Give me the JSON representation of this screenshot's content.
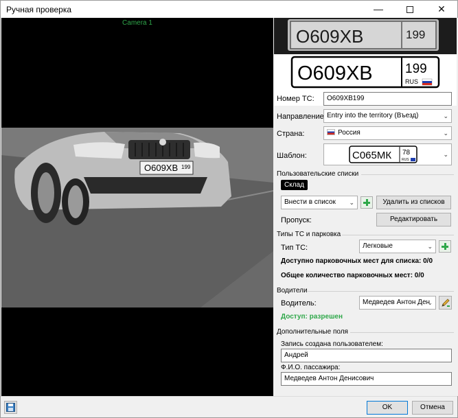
{
  "window": {
    "title": "Ручная проверка",
    "minimize_glyph": "—",
    "close_glyph": "✕"
  },
  "video": {
    "camera_label": "Camera 1",
    "scene_plate_text": "O609XB",
    "scene_plate_region": "199"
  },
  "plate_crop": {
    "text": "O609XB",
    "region": "199"
  },
  "plate_render": {
    "number": "О609ХВ",
    "region": "199",
    "country_code": "RUS"
  },
  "form": {
    "plate_label": "Номер ТС:",
    "plate_value": "О609ХВ199",
    "direction_label": "Направление:",
    "direction_value": "Entry into the territory (Въезд)",
    "country_label": "Страна:",
    "country_value": "Россия",
    "template_label": "Шаблон:",
    "template_plate": {
      "number": "С065МК",
      "region": "78",
      "country_code": "RUS"
    }
  },
  "user_lists": {
    "section_title": "Пользовательские списки",
    "tag": "Склад",
    "add_to_list_value": "Внести в список",
    "remove_button": "Удалить из списков",
    "pass_label": "Пропуск:",
    "edit_button": "Редактировать"
  },
  "vehicle_types": {
    "section_title": "Типы ТС и парковка",
    "type_label": "Тип ТС:",
    "type_value": "Легковые",
    "available_list": "Доступно парковочных мест для списка: 0/0",
    "total_places": "Общее количество парковочных мест: 0/0"
  },
  "drivers": {
    "section_title": "Водители",
    "driver_label": "Водитель:",
    "driver_value": "Медведев Антон Ден",
    "access_status": "Доступ: разрешен",
    "access_color": "#2fa84a"
  },
  "extra": {
    "section_title": "Дополнительные поля",
    "created_by_label": "Запись создана пользователем:",
    "created_by_value": "Андрей",
    "passenger_label": "Ф.И.О. пассажира:",
    "passenger_value": "Медведев Антон Денисович"
  },
  "footer": {
    "ok": "OK",
    "cancel": "Отмена"
  },
  "icons": {
    "save": "save-icon",
    "add": "plus-icon",
    "edit": "pencil-icon",
    "dropdown": "chevron-down-icon",
    "flag": "russia-flag-icon"
  }
}
